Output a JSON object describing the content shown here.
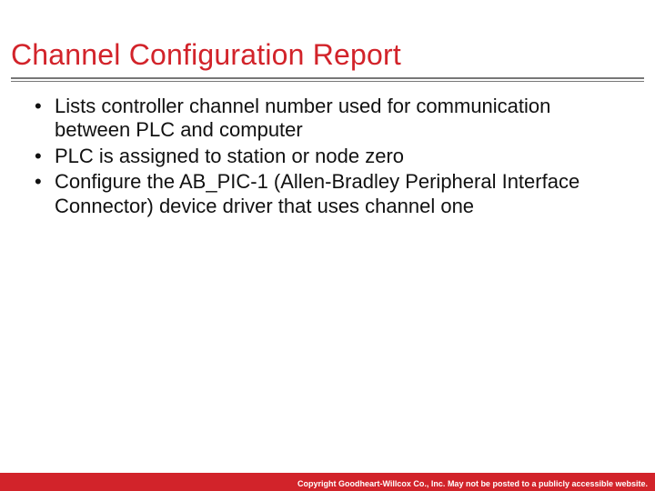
{
  "title": "Channel Configuration Report",
  "bullets": [
    "Lists controller channel number used for communication between PLC and computer",
    "PLC is assigned to station or node zero",
    "Configure the AB_PIC-1 (Allen-Bradley Peripheral Interface Connector) device driver that uses channel one"
  ],
  "footer": "Copyright Goodheart-Willcox Co., Inc.  May not be posted to a publicly accessible website."
}
